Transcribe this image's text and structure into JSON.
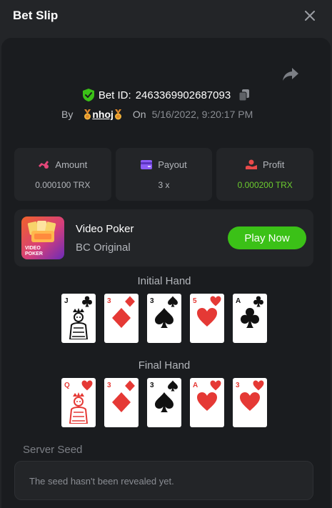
{
  "header": {
    "title": "Bet Slip"
  },
  "bet": {
    "id_label": "Bet ID:",
    "id_value": "2463369902687093",
    "by_label": "By",
    "username": "nhoj",
    "on_label": "On",
    "datetime": "5/16/2022, 9:20:17 PM"
  },
  "stats": [
    {
      "label": "Amount",
      "value": "0.000100 TRX",
      "icon": "amount-icon",
      "color": "#e5477a"
    },
    {
      "label": "Payout",
      "value": "3 x",
      "icon": "payout-icon",
      "color": "#8b5cf6"
    },
    {
      "label": "Profit",
      "value": "0.000200 TRX",
      "icon": "profit-icon",
      "color": "#e84a4a"
    }
  ],
  "game": {
    "name": "Video Poker",
    "subtitle": "BC Original",
    "play_label": "Play Now",
    "thumb_text": "VIDEO POKER"
  },
  "initial_hand": {
    "title": "Initial Hand",
    "cards": [
      {
        "rank": "J",
        "suit": "club",
        "color": "#111111"
      },
      {
        "rank": "3",
        "suit": "diamond",
        "color": "#e53935"
      },
      {
        "rank": "3",
        "suit": "spade",
        "color": "#111111"
      },
      {
        "rank": "5",
        "suit": "heart",
        "color": "#e53935"
      },
      {
        "rank": "A",
        "suit": "club",
        "color": "#111111"
      }
    ]
  },
  "final_hand": {
    "title": "Final Hand",
    "cards": [
      {
        "rank": "Q",
        "suit": "heart",
        "color": "#e53935"
      },
      {
        "rank": "3",
        "suit": "diamond",
        "color": "#e53935"
      },
      {
        "rank": "3",
        "suit": "spade",
        "color": "#111111"
      },
      {
        "rank": "A",
        "suit": "heart",
        "color": "#e53935"
      },
      {
        "rank": "3",
        "suit": "heart",
        "color": "#e53935"
      }
    ]
  },
  "server_seed": {
    "label": "Server Seed",
    "text": "The seed hasn't been revealed yet."
  },
  "colors": {
    "accent_green": "#3bc117",
    "profit_green": "#6ccc2f",
    "verified_green": "#3bc117"
  }
}
